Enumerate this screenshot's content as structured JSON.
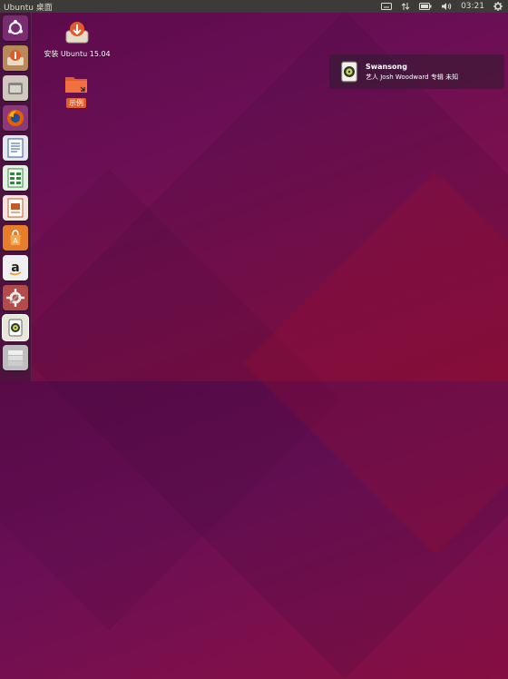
{
  "top_panel": {
    "title": "Ubuntu 桌面",
    "clock": "03:21"
  },
  "desktop": {
    "install_icon_label": "安装 Ubuntu 15.04",
    "folder_label": "示例"
  },
  "notification": {
    "title": "Swansong",
    "body": "艺人 Josh Woodward 专辑 未知"
  },
  "launcher": {
    "items": [
      {
        "name": "ubuntu-dash",
        "icon": "ubuntu-logo-icon",
        "color": "#9b3b8a"
      },
      {
        "name": "installer",
        "icon": "installer-icon",
        "color": "#c9a46e"
      },
      {
        "name": "files",
        "icon": "file-manager-icon",
        "color": "#d4cfc8"
      },
      {
        "name": "firefox",
        "icon": "firefox-icon",
        "color": "#e66000"
      },
      {
        "name": "writer",
        "icon": "writer-icon",
        "color": "#2f5c9b"
      },
      {
        "name": "calc",
        "icon": "calc-icon",
        "color": "#2f8a3a"
      },
      {
        "name": "impress",
        "icon": "impress-icon",
        "color": "#c25b2a"
      },
      {
        "name": "software-center",
        "icon": "software-center-icon",
        "color": "#e67d2a"
      },
      {
        "name": "amazon",
        "icon": "amazon-icon",
        "color": "#f2f2f2"
      },
      {
        "name": "settings",
        "icon": "settings-icon",
        "color": "#b44b4b"
      },
      {
        "name": "rhythmbox",
        "icon": "rhythmbox-icon",
        "color": "#e9e6da"
      },
      {
        "name": "workspaces",
        "icon": "workspaces-icon",
        "color": "#cfcfcf"
      }
    ]
  }
}
